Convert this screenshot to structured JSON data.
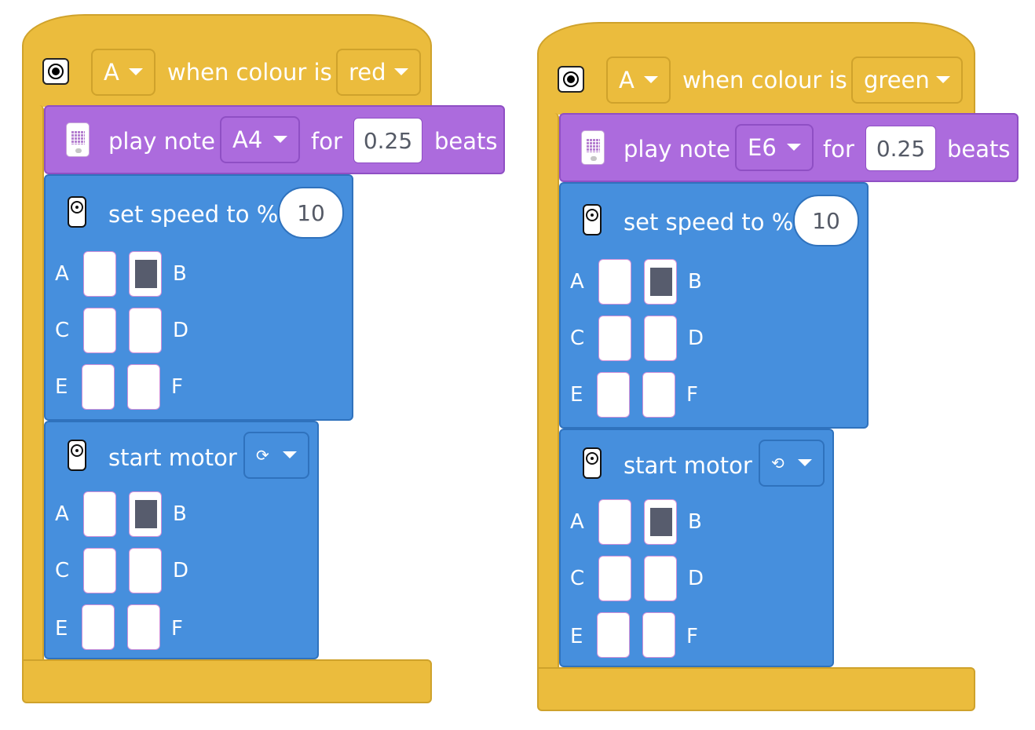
{
  "colors": {
    "event": "#ebbc3d",
    "sound": "#ac6bdd",
    "motor": "#468fdd"
  },
  "icons": {
    "event": "color-sensor-icon",
    "sound": "hub-icon",
    "motor": "motor-icon"
  },
  "stacks": [
    {
      "hat": {
        "port": "A",
        "text": "when colour is",
        "color": "red"
      },
      "note": {
        "text": "play note",
        "note": "A4",
        "for": "for",
        "beats": "0.25",
        "beats_label": "beats"
      },
      "speed": {
        "text": "set speed to %",
        "value": "10",
        "ports": {
          "A": "A",
          "B": "B",
          "C": "C",
          "D": "D",
          "E": "E",
          "F": "F"
        },
        "selected": [
          "B"
        ]
      },
      "motor": {
        "text": "start motor",
        "direction": "⟳",
        "ports": {
          "A": "A",
          "B": "B",
          "C": "C",
          "D": "D",
          "E": "E",
          "F": "F"
        },
        "selected": [
          "B"
        ]
      }
    },
    {
      "hat": {
        "port": "A",
        "text": "when colour is",
        "color": "green"
      },
      "note": {
        "text": "play note",
        "note": "E6",
        "for": "for",
        "beats": "0.25",
        "beats_label": "beats"
      },
      "speed": {
        "text": "set speed to %",
        "value": "10",
        "ports": {
          "A": "A",
          "B": "B",
          "C": "C",
          "D": "D",
          "E": "E",
          "F": "F"
        },
        "selected": [
          "B"
        ]
      },
      "motor": {
        "text": "start motor",
        "direction": "⟲",
        "ports": {
          "A": "A",
          "B": "B",
          "C": "C",
          "D": "D",
          "E": "E",
          "F": "F"
        },
        "selected": [
          "B"
        ]
      }
    }
  ]
}
